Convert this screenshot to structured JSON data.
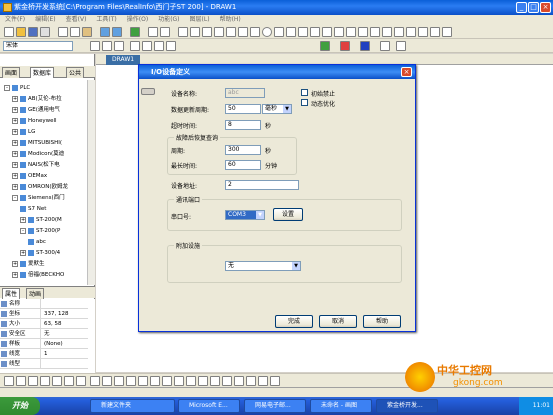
{
  "app": {
    "title": "紫金桥开发系统[C:\\Program Files\\RealInfo\\西门子ST 200] - DRAW1"
  },
  "menu": [
    "文件(F)",
    "编辑(E)",
    "查看(V)",
    "工具(T)",
    "操作(O)",
    "功能(G)",
    "图层(L)",
    "帮助(H)"
  ],
  "toolbar": {
    "font": "宋体"
  },
  "left_tabs": [
    "画面",
    "数据库",
    "公共"
  ],
  "tree": [
    {
      "label": "PLC",
      "level": 0,
      "exp": "-"
    },
    {
      "label": "AB(艾伦-布拉",
      "level": 1,
      "exp": "+"
    },
    {
      "label": "GE(通用电气",
      "level": 1,
      "exp": "+"
    },
    {
      "label": "Honeywell",
      "level": 1,
      "exp": "+"
    },
    {
      "label": "LG",
      "level": 1,
      "exp": "+"
    },
    {
      "label": "MITSUBISHI(",
      "level": 1,
      "exp": "+"
    },
    {
      "label": "Modicon(莫迪",
      "level": 1,
      "exp": "+"
    },
    {
      "label": "NAIS(松下电",
      "level": 1,
      "exp": "+"
    },
    {
      "label": "OEMax",
      "level": 1,
      "exp": "+"
    },
    {
      "label": "OMRON(欧姆龙",
      "level": 1,
      "exp": "+"
    },
    {
      "label": "Siemens(西门",
      "level": 1,
      "exp": "-"
    },
    {
      "label": "S7 Net",
      "level": 2,
      "exp": ""
    },
    {
      "label": "ST-200(M",
      "level": 2,
      "exp": "+"
    },
    {
      "label": "ST-200(P",
      "level": 2,
      "exp": "-"
    },
    {
      "label": "abc",
      "level": 3,
      "exp": ""
    },
    {
      "label": "ST-300/4",
      "level": 2,
      "exp": "+"
    },
    {
      "label": "爱默生",
      "level": 1,
      "exp": "+"
    },
    {
      "label": "倍福(BECKHO",
      "level": 1,
      "exp": "+"
    }
  ],
  "prop_tabs": [
    "属性",
    "动画"
  ],
  "props": [
    {
      "k": "名称",
      "v": ""
    },
    {
      "k": "坐标",
      "v": "337, 128"
    },
    {
      "k": "大小",
      "v": "63, 58"
    },
    {
      "k": "安全区",
      "v": "无"
    },
    {
      "k": "样板",
      "v": "(None)"
    },
    {
      "k": "线宽",
      "v": "1"
    },
    {
      "k": "线型",
      "v": ""
    }
  ],
  "canvas_tab": "DRAW1",
  "dialog": {
    "title": "I/O设备定义",
    "device_name_label": "设备名称:",
    "device_name": "abc",
    "update_cycle_label": "数据更新周期:",
    "update_cycle": "50",
    "update_unit": "毫秒",
    "timeout_label": "超时时间:",
    "timeout": "8",
    "timeout_unit": "秒",
    "init_disable": "初始禁止",
    "dynamic_opt": "动态优化",
    "recover_group": "故障后恢复查询",
    "period_label": "周期:",
    "period": "300",
    "period_unit": "秒",
    "max_time_label": "最长时间:",
    "max_time": "60",
    "max_time_unit": "分钟",
    "address_label": "设备地址:",
    "address": "2",
    "port_group": "通讯端口",
    "port_label": "串口号:",
    "port": "COM3",
    "setup_btn": "设置",
    "extra_group": "附加设施",
    "extra_value": "无",
    "ok": "完成",
    "cancel": "取消",
    "help": "帮助"
  },
  "status": "",
  "taskbar": {
    "start": "开始",
    "tasks": [
      "新建文件夹",
      "Microsoft E...",
      "网易电子邮...",
      "未命名 - 画图",
      "紫金桥开发..."
    ],
    "clock": "11:01"
  },
  "watermark": {
    "line1": "中华工控网",
    "line2": "gkong.com"
  }
}
